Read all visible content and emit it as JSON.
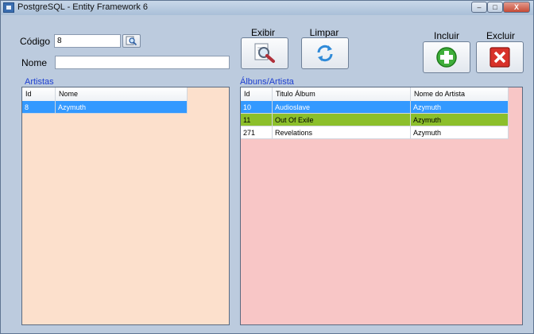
{
  "window": {
    "title": "PostgreSQL - Entity Framework 6",
    "minimize": "–",
    "maximize": "□",
    "close": "X"
  },
  "form": {
    "codigo_label": "Código",
    "codigo_value": "8",
    "nome_label": "Nome",
    "nome_value": ""
  },
  "buttons": {
    "exibir": "Exibir",
    "limpar": "Limpar",
    "incluir": "Incluir",
    "excluir": "Excluir"
  },
  "artistas": {
    "label": "Artistas",
    "columns": [
      "Id",
      "Nome"
    ],
    "rows": [
      {
        "id": "8",
        "nome": "Azymuth"
      }
    ]
  },
  "albuns": {
    "label": "Álbuns/Artista",
    "columns": [
      "Id",
      "Titulo Álbum",
      "Nome do Artista"
    ],
    "rows": [
      {
        "id": "10",
        "titulo": "Audioslave",
        "artista": "Azymuth"
      },
      {
        "id": "11",
        "titulo": "Out Of Exile",
        "artista": "Azymuth"
      },
      {
        "id": "271",
        "titulo": "Revelations",
        "artista": "Azymuth"
      }
    ]
  },
  "colors": {
    "selected_row": "#3399ff",
    "highlight_row": "#8cbf2b",
    "artistas_bg": "#fce0cc",
    "albuns_bg": "#f8c6c6"
  }
}
